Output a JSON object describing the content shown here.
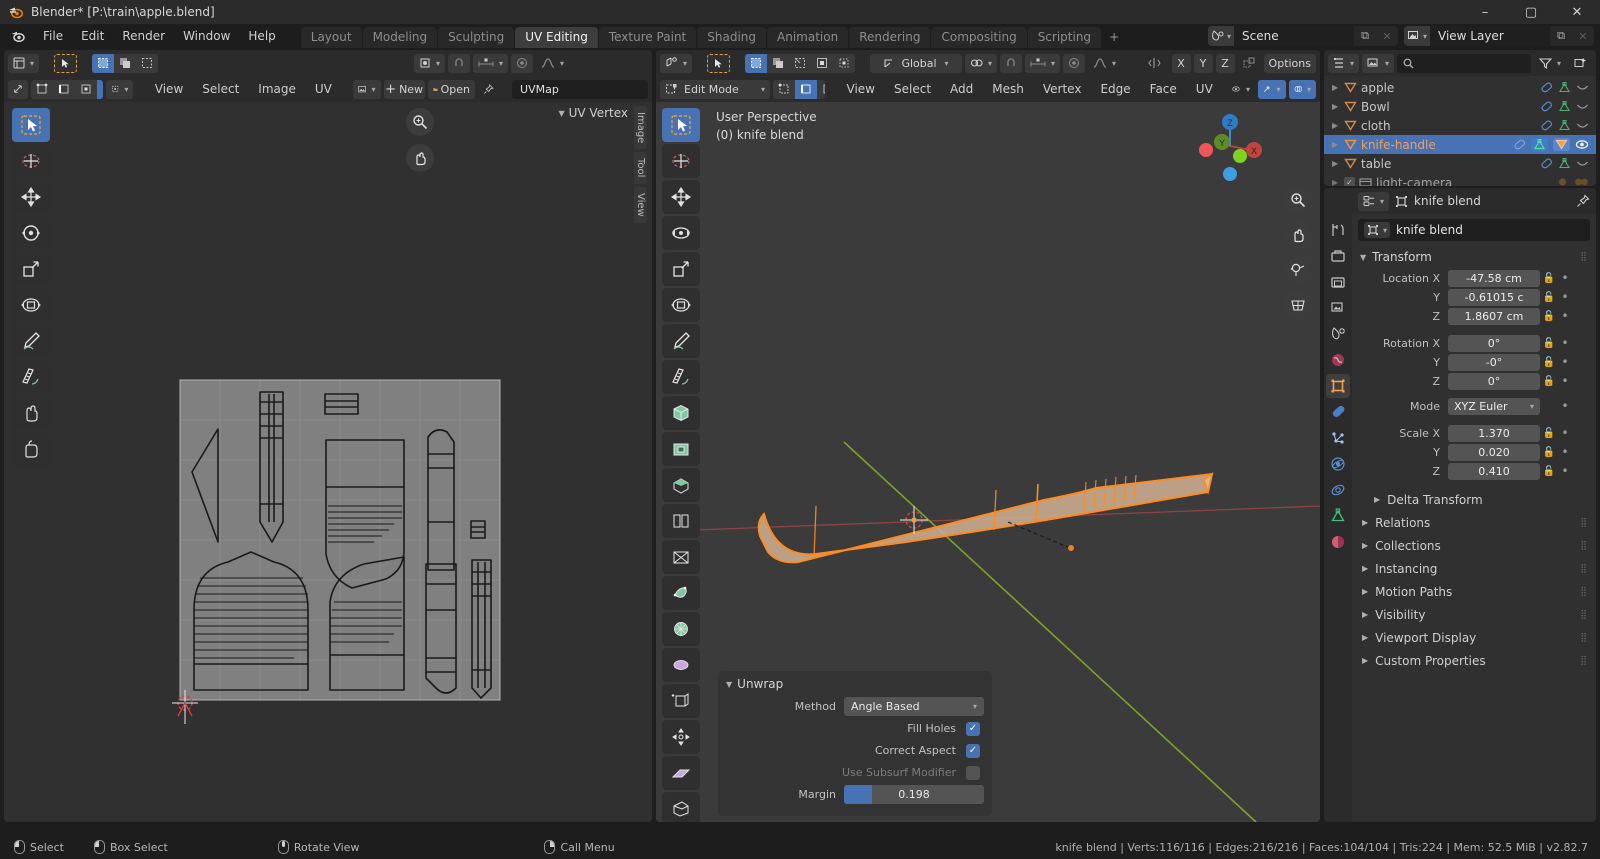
{
  "window": {
    "title": "Blender* [P:\\train\\apple.blend]",
    "minimize": "–",
    "maximize": "▢",
    "close": "✕"
  },
  "topbar": {
    "menus": [
      "File",
      "Edit",
      "Render",
      "Window",
      "Help"
    ],
    "workspaces": [
      {
        "label": "Layout",
        "active": false
      },
      {
        "label": "Modeling",
        "active": false
      },
      {
        "label": "Sculpting",
        "active": false
      },
      {
        "label": "UV Editing",
        "active": true
      },
      {
        "label": "Texture Paint",
        "active": false
      },
      {
        "label": "Shading",
        "active": false
      },
      {
        "label": "Animation",
        "active": false
      },
      {
        "label": "Rendering",
        "active": false
      },
      {
        "label": "Compositing",
        "active": false
      },
      {
        "label": "Scripting",
        "active": false
      }
    ],
    "add_workspace": "+",
    "scene": {
      "name": "Scene",
      "copy": "⧉",
      "remove": "✕"
    },
    "view_layer": {
      "name": "View Layer",
      "copy": "⧉",
      "remove": "✕"
    }
  },
  "uv_editor": {
    "header_row1": {
      "editor_type": "uv-editor-icon",
      "tool_active": "tweak",
      "select_modes": [
        "set",
        "extend",
        "subtract"
      ],
      "pivot": "pivot-icon",
      "snap": "snap-icon",
      "proportional": "proportional-icon",
      "falloff": "falloff-icon"
    },
    "header_row2": {
      "sync_label": "uv-sync-selection",
      "sel_modes": [
        "vertex",
        "edge",
        "face",
        "island"
      ],
      "sticky": "sticky-icon",
      "menus": [
        "View",
        "Select",
        "Image",
        "UV"
      ],
      "browse": "browse-image",
      "new_label": "New",
      "open_label": "Open",
      "pin": "pin-icon",
      "uvmap_name": "UVMap"
    },
    "overlay_label": "UV Vertex",
    "side_tabs": [
      "Image",
      "Tool",
      "View"
    ],
    "tools": [
      {
        "name": "tweak",
        "active": true
      },
      {
        "name": "cursor",
        "active": false
      },
      {
        "name": "move",
        "active": false
      },
      {
        "name": "rotate",
        "active": false
      },
      {
        "name": "scale",
        "active": false
      },
      {
        "name": "transform",
        "active": false
      },
      {
        "name": "annotate",
        "active": false
      },
      {
        "name": "measure",
        "active": false
      },
      {
        "name": "grab",
        "active": false
      },
      {
        "name": "relax",
        "active": false
      }
    ],
    "zoom_controls": [
      "zoom-icon",
      "pan-icon"
    ]
  },
  "view3d": {
    "header_row1": {
      "editor_type": "view3d-icon",
      "tool_active": "tweak",
      "select_modes": [
        "set",
        "extend",
        "subtract",
        "invert",
        "intersect"
      ],
      "transform_orientation": "Global",
      "snap": "snap-icon",
      "proportional": "proportional-icon",
      "falloff": "falloff-icon",
      "mirror_label": "mirror-icon",
      "axes": [
        "X",
        "Y",
        "Z"
      ],
      "options_label": "Options"
    },
    "header_row2": {
      "mode": "Edit Mode",
      "mesh_select_modes": [
        "vertex",
        "edge",
        "face"
      ],
      "mesh_select_active": "edge",
      "menus": [
        "View",
        "Select",
        "Add",
        "Mesh",
        "Vertex",
        "Edge",
        "Face",
        "UV"
      ],
      "visibility": "eye-icon",
      "gizmo": "gizmo-icon",
      "overlays": "overlays-icon"
    },
    "info_lines": [
      "User Perspective",
      "(0) knife blend"
    ],
    "gizmo_axes": [
      "X",
      "Y",
      "Z"
    ],
    "nav_buttons": [
      "zoom-icon",
      "pan-icon",
      "camera-icon",
      "ortho-persp-icon"
    ],
    "operator_panel": {
      "title": "Unwrap",
      "method_label": "Method",
      "method_value": "Angle Based",
      "fill_holes_label": "Fill Holes",
      "fill_holes": true,
      "correct_aspect_label": "Correct Aspect",
      "correct_aspect": true,
      "use_subsurf_label": "Use Subsurf Modifier",
      "use_subsurf": false,
      "margin_label": "Margin",
      "margin_value": "0.198",
      "margin_pct": 19.8
    }
  },
  "outliner": {
    "display_mode": "view-layer-icon",
    "filter_icon": "filter-icon",
    "new_collection_icon": "new-collection-icon",
    "search_placeholder": "",
    "rows": [
      {
        "name": "apple",
        "selected": false,
        "icons": [
          "modifier",
          "mesh"
        ],
        "vis": "hidden-curve"
      },
      {
        "name": "Bowl",
        "selected": false,
        "icons": [
          "modifier",
          "mesh"
        ],
        "vis": "hidden-curve"
      },
      {
        "name": "cloth",
        "selected": false,
        "icons": [
          "modifier",
          "mesh"
        ],
        "vis": "hidden-curve"
      },
      {
        "name": "knife-handle",
        "selected": true,
        "icons": [
          "modifier",
          "mesh",
          "object"
        ],
        "vis": "eye"
      },
      {
        "name": "table",
        "selected": false,
        "icons": [
          "modifier",
          "mesh"
        ],
        "vis": "hidden-curve"
      },
      {
        "name": "light-camera",
        "selected": false,
        "icons": [
          "light",
          "camera"
        ],
        "vis": ""
      }
    ]
  },
  "properties": {
    "breadcrumb_icon": "object-icon",
    "breadcrumb_name": "knife blend",
    "pin_icon": "pin-icon",
    "object_name": "knife blend",
    "tabs": [
      {
        "name": "tool",
        "active": false
      },
      {
        "name": "render",
        "active": false
      },
      {
        "name": "output",
        "active": false
      },
      {
        "name": "view-layer",
        "active": false
      },
      {
        "name": "scene",
        "active": false
      },
      {
        "name": "world",
        "active": false
      },
      {
        "name": "object",
        "active": true
      },
      {
        "name": "modifiers",
        "active": false
      },
      {
        "name": "particles",
        "active": false
      },
      {
        "name": "physics",
        "active": false
      },
      {
        "name": "constraints",
        "active": false
      },
      {
        "name": "data",
        "active": false
      },
      {
        "name": "material",
        "active": false
      }
    ],
    "transform": {
      "title": "Transform",
      "location": {
        "label_x": "Location X",
        "label_y": "Y",
        "label_z": "Z",
        "x": "-47.58 cm",
        "y": "-0.61015 c",
        "z": "1.8607 cm"
      },
      "rotation": {
        "label_x": "Rotation X",
        "label_y": "Y",
        "label_z": "Z",
        "x": "0°",
        "y": "-0°",
        "z": "0°"
      },
      "mode_label": "Mode",
      "mode_value": "XYZ Euler",
      "scale": {
        "label_x": "Scale X",
        "label_y": "Y",
        "label_z": "Z",
        "x": "1.370",
        "y": "0.020",
        "z": "0.410"
      },
      "delta_transform": "Delta Transform"
    },
    "sections": [
      "Relations",
      "Collections",
      "Instancing",
      "Motion Paths",
      "Visibility",
      "Viewport Display",
      "Custom Properties"
    ]
  },
  "status_bar": {
    "keys": [
      {
        "mouse": "left",
        "label": "Select"
      },
      {
        "mouse": "left-drag",
        "label": "Box Select"
      },
      {
        "mouse": "middle",
        "label": "Rotate View"
      },
      {
        "mouse": "right",
        "label": "Call Menu"
      }
    ],
    "stats": "knife blend | Verts:116/116 | Edges:216/216 | Faces:104/104 | Tris:224 | Mem: 52.5 MiB | v2.82.7"
  },
  "colors": {
    "accent_blue": "#4772b3",
    "selected_orange": "#ff8b1e",
    "mesh_green": "#41b46a",
    "axis_x": "#c04040",
    "axis_y": "#7ba428"
  }
}
